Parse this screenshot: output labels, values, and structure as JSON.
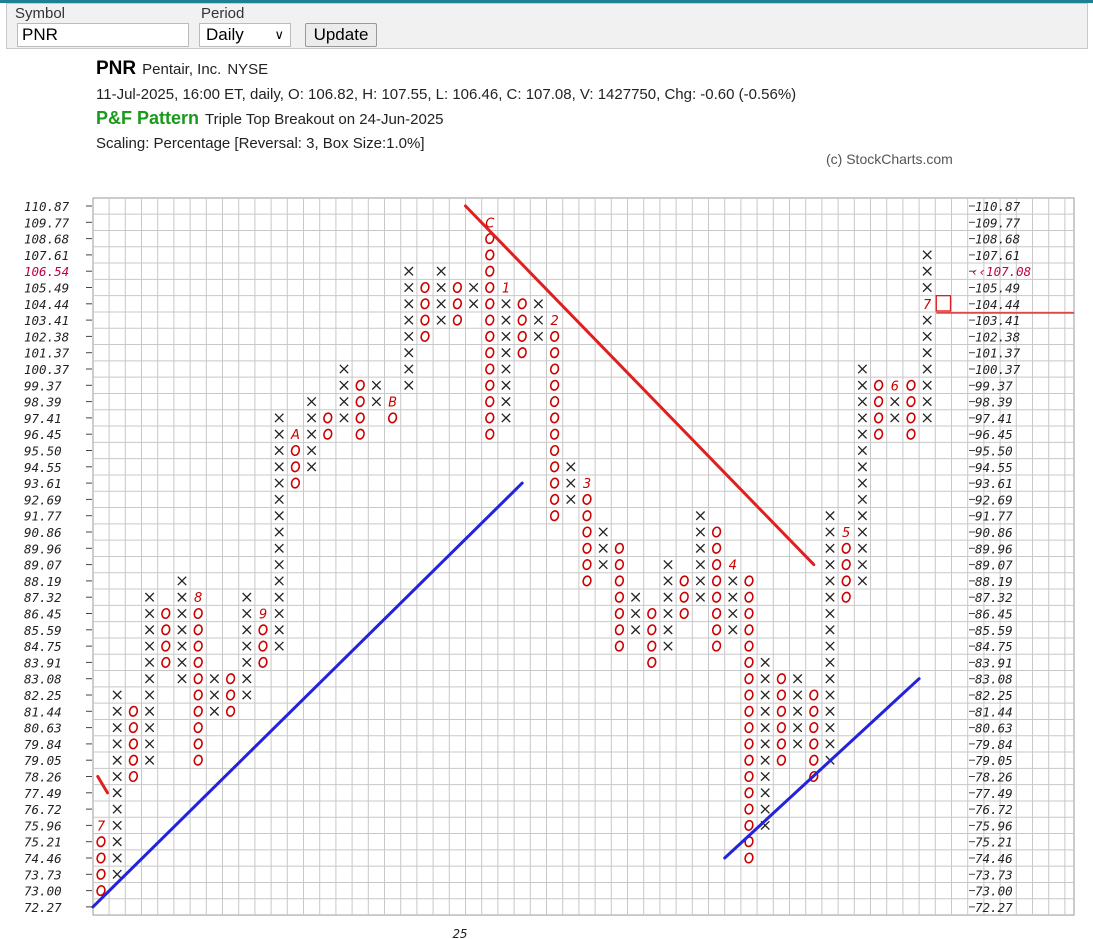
{
  "toolbar": {
    "symbol_label": "Symbol",
    "symbol_value": "PNR",
    "period_label": "Period",
    "period_value": "Daily",
    "update_label": "Update"
  },
  "header": {
    "symbol": "PNR",
    "name": "Pentair, Inc.",
    "exchange": "NYSE",
    "quote": "11-Jul-2025, 16:00 ET, daily, O: 106.82, H: 107.55, L: 106.46, C: 107.08, V: 1427750, Chg: -0.60 (-0.56%)",
    "pattern_label": "P&F Pattern",
    "pattern_desc": "Triple Top Breakout on 24-Jun-2025",
    "scaling": "Scaling: Percentage [Reversal: 3, Box Size:1.0%]",
    "copyright": "(c) StockCharts.com"
  },
  "colors": {
    "x_mark": "#222222",
    "o_mark": "#cc0000",
    "resistance_line": "#e02020",
    "support_line": "#2323dd",
    "grid": "#c8c8c8",
    "highlight_price": "#c0004a"
  },
  "chart_data": {
    "type": "point-and-figure",
    "price_levels": [
      "110.87",
      "109.77",
      "108.68",
      "107.61",
      "106.54",
      "105.49",
      "104.44",
      "103.41",
      "102.38",
      "101.37",
      "100.37",
      "99.37",
      "98.39",
      "97.41",
      "96.45",
      "95.50",
      "94.55",
      "93.61",
      "92.69",
      "91.77",
      "90.86",
      "89.96",
      "89.07",
      "88.19",
      "87.32",
      "86.45",
      "85.59",
      "84.75",
      "83.91",
      "83.08",
      "82.25",
      "81.44",
      "80.63",
      "79.84",
      "79.05",
      "78.26",
      "77.49",
      "76.72",
      "75.96",
      "75.21",
      "74.46",
      "73.73",
      "73.00",
      "72.27"
    ],
    "highlight_left": "106.54",
    "last_price_label": "107.08",
    "x_axis_label": "25",
    "columns": [
      {
        "type": "O",
        "top": "75.96",
        "bottom": "73.00",
        "month": "7"
      },
      {
        "type": "X",
        "top": "82.25",
        "bottom": "73.73"
      },
      {
        "type": "O",
        "top": "81.44",
        "bottom": "78.26"
      },
      {
        "type": "X",
        "top": "87.32",
        "bottom": "79.05"
      },
      {
        "type": "O",
        "top": "86.45",
        "bottom": "83.91"
      },
      {
        "type": "X",
        "top": "88.19",
        "bottom": "83.08"
      },
      {
        "type": "O",
        "top": "87.32",
        "bottom": "79.05",
        "month": "8"
      },
      {
        "type": "X",
        "top": "83.08",
        "bottom": "81.44"
      },
      {
        "type": "O",
        "top": "83.08",
        "bottom": "81.44"
      },
      {
        "type": "X",
        "top": "87.32",
        "bottom": "82.25"
      },
      {
        "type": "O",
        "top": "86.45",
        "bottom": "83.91",
        "month": "9"
      },
      {
        "type": "X",
        "top": "97.41",
        "bottom": "84.75"
      },
      {
        "type": "O",
        "top": "96.45",
        "bottom": "93.61",
        "month": "A"
      },
      {
        "type": "X",
        "top": "98.39",
        "bottom": "94.55"
      },
      {
        "type": "O",
        "top": "97.41",
        "bottom": "96.45"
      },
      {
        "type": "X",
        "top": "100.37",
        "bottom": "97.41"
      },
      {
        "type": "O",
        "top": "99.37",
        "bottom": "96.45"
      },
      {
        "type": "X",
        "top": "99.37",
        "bottom": "98.39"
      },
      {
        "type": "O",
        "top": "98.39",
        "bottom": "97.41",
        "month": "B"
      },
      {
        "type": "X",
        "top": "106.54",
        "bottom": "99.37"
      },
      {
        "type": "O",
        "top": "105.49",
        "bottom": "102.38"
      },
      {
        "type": "X",
        "top": "106.54",
        "bottom": "103.41"
      },
      {
        "type": "O",
        "top": "105.49",
        "bottom": "103.41"
      },
      {
        "type": "X",
        "top": "105.49",
        "bottom": "104.44"
      },
      {
        "type": "O",
        "top": "109.77",
        "bottom": "96.45",
        "month": "C"
      },
      {
        "type": "X",
        "top": "105.49",
        "bottom": "97.41",
        "month": "1"
      },
      {
        "type": "O",
        "top": "104.44",
        "bottom": "101.37"
      },
      {
        "type": "X",
        "top": "104.44",
        "bottom": "102.38"
      },
      {
        "type": "O",
        "top": "103.41",
        "bottom": "91.77",
        "month": "2"
      },
      {
        "type": "X",
        "top": "94.55",
        "bottom": "92.69"
      },
      {
        "type": "O",
        "top": "93.61",
        "bottom": "88.19",
        "month": "3"
      },
      {
        "type": "X",
        "top": "90.86",
        "bottom": "89.07"
      },
      {
        "type": "O",
        "top": "89.96",
        "bottom": "84.75"
      },
      {
        "type": "X",
        "top": "87.32",
        "bottom": "85.59"
      },
      {
        "type": "O",
        "top": "86.45",
        "bottom": "83.91"
      },
      {
        "type": "X",
        "top": "89.07",
        "bottom": "84.75"
      },
      {
        "type": "O",
        "top": "88.19",
        "bottom": "86.45"
      },
      {
        "type": "X",
        "top": "91.77",
        "bottom": "87.32"
      },
      {
        "type": "O",
        "top": "90.86",
        "bottom": "84.75"
      },
      {
        "type": "X",
        "top": "89.07",
        "bottom": "85.59",
        "month": "4"
      },
      {
        "type": "O",
        "top": "88.19",
        "bottom": "74.46"
      },
      {
        "type": "X",
        "top": "83.91",
        "bottom": "75.96"
      },
      {
        "type": "O",
        "top": "83.08",
        "bottom": "79.05"
      },
      {
        "type": "X",
        "top": "83.08",
        "bottom": "79.84"
      },
      {
        "type": "O",
        "top": "82.25",
        "bottom": "78.26"
      },
      {
        "type": "X",
        "top": "91.77",
        "bottom": "79.05"
      },
      {
        "type": "O",
        "top": "90.86",
        "bottom": "87.32",
        "month": "5"
      },
      {
        "type": "X",
        "top": "100.37",
        "bottom": "88.19"
      },
      {
        "type": "O",
        "top": "99.37",
        "bottom": "96.45"
      },
      {
        "type": "X",
        "top": "99.37",
        "bottom": "97.41",
        "month": "6"
      },
      {
        "type": "O",
        "top": "99.37",
        "bottom": "96.45"
      },
      {
        "type": "X",
        "top": "107.61",
        "bottom": "97.41",
        "month": "7",
        "month_at": "104.44"
      }
    ],
    "trendlines": [
      {
        "kind": "resistance",
        "from": {
          "col": 22.5,
          "price": "110.87"
        },
        "to": {
          "col": 44,
          "price": "89.07"
        }
      },
      {
        "kind": "resistance",
        "from": {
          "col": -0.2,
          "price": "78.26"
        },
        "to": {
          "col": 0.4,
          "price": "77.49"
        }
      },
      {
        "kind": "support",
        "from": {
          "col": -0.5,
          "price": "72.27"
        },
        "to": {
          "col": 26,
          "price": "93.61"
        }
      },
      {
        "kind": "support",
        "from": {
          "col": 38.5,
          "price": "74.46"
        },
        "to": {
          "col": 50.5,
          "price": "83.08"
        }
      }
    ]
  }
}
